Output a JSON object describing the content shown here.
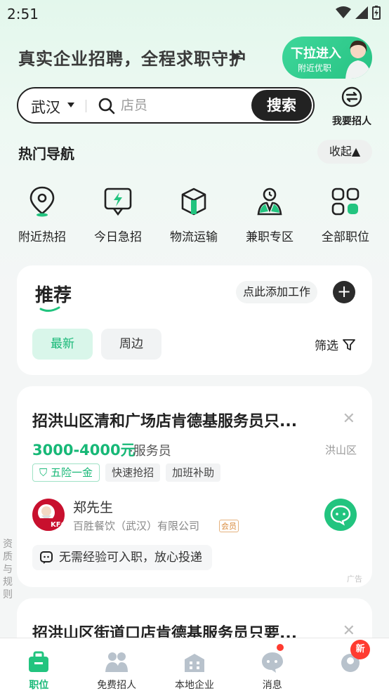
{
  "status_bar": {
    "time": "2:51"
  },
  "banner": {
    "text": "真实企业招聘，全程求职守护",
    "pull_title": "下拉进入",
    "pull_sub": "附近优职"
  },
  "search": {
    "city": "武汉",
    "placeholder": "店员",
    "button": "搜索"
  },
  "hire": {
    "label": "我要招人"
  },
  "hot_nav": {
    "title": "热门导航",
    "collapse": "收起▲",
    "items": [
      {
        "label": "附近热招",
        "icon": "location-pin-icon"
      },
      {
        "label": "今日急招",
        "icon": "lightning-board-icon"
      },
      {
        "label": "物流运输",
        "icon": "package-icon"
      },
      {
        "label": "兼职专区",
        "icon": "person-clock-icon"
      },
      {
        "label": "全部职位",
        "icon": "grid-icon"
      }
    ]
  },
  "recommend": {
    "title": "推荐",
    "add_job": "点此添加工作",
    "tabs": [
      "最新",
      "周边"
    ],
    "filter": "筛选"
  },
  "jobs": [
    {
      "title": "招洪山区清和广场店肯德基服务员只...",
      "salary": "3000-4000元",
      "role": "·服务员",
      "area": "洪山区",
      "tags": [
        "五险一金",
        "快速抢招",
        "加班补助"
      ],
      "contact": "郑先生",
      "company": "百胜餐饮（武汉）有限公司",
      "vip": "会员",
      "note": "无需经验可入职，放心投递",
      "ad": "广告",
      "logo_text": "KFC"
    },
    {
      "title": "招洪山区街道口店肯德基服务员只要..."
    }
  ],
  "side_rule": "资质与规则",
  "bottom_nav": [
    {
      "label": "职位",
      "icon": "briefcase-icon",
      "active": true
    },
    {
      "label": "免费招人",
      "icon": "people-icon"
    },
    {
      "label": "本地企业",
      "icon": "building-icon"
    },
    {
      "label": "消息",
      "icon": "chat-icon"
    },
    {
      "label": "",
      "icon": "profile-icon",
      "badge": "新"
    }
  ],
  "colors": {
    "accent": "#17b877",
    "dark": "#222222"
  }
}
